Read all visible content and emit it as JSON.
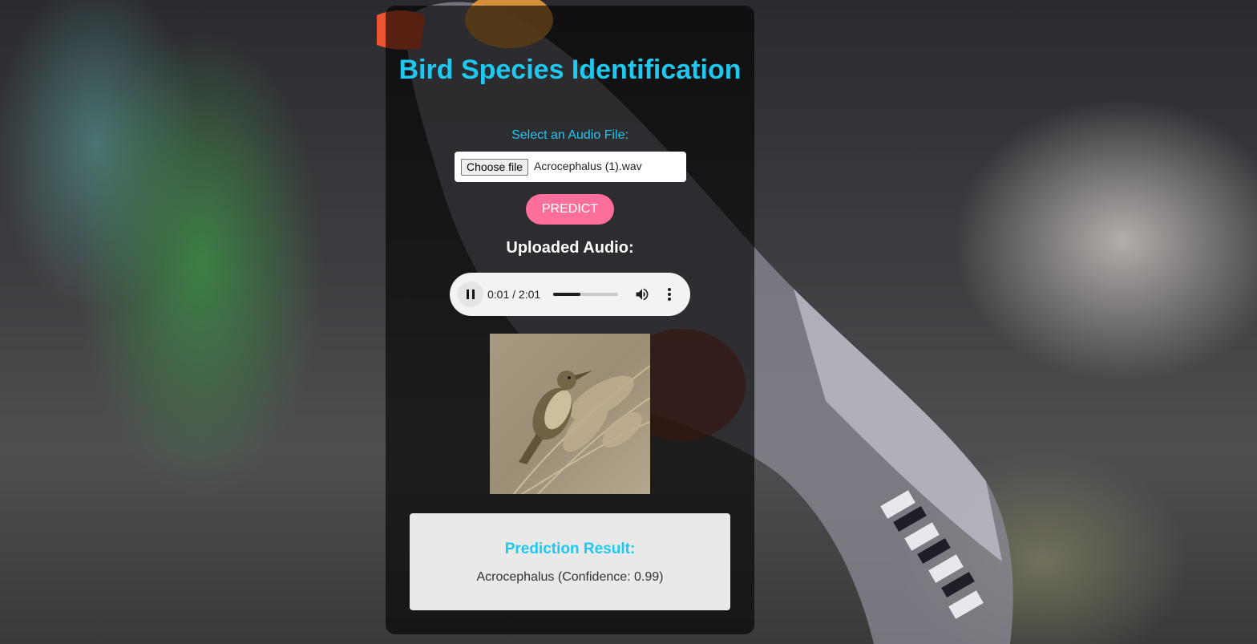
{
  "page": {
    "title": "Bird Species Identification"
  },
  "form": {
    "select_label": "Select an Audio File:",
    "choose_file_label": "Choose file",
    "file_name": "Acrocephalus (1).wav",
    "predict_label": "PREDICT"
  },
  "audio": {
    "heading": "Uploaded Audio:",
    "time_display": "0:01 / 2:01",
    "progress_fraction": 0.42,
    "play_state": "playing",
    "play_icon": "pause-icon",
    "volume_icon": "volume-icon",
    "menu_icon": "more-vert-icon"
  },
  "result": {
    "heading": "Prediction Result:",
    "text": "Acrocephalus (Confidence: 0.99)"
  },
  "colors": {
    "accent": "#1ec8ef",
    "predict_button": "#ff6f9c",
    "panel": "rgba(0,0,0,0.62)",
    "result_box": "#e9e9e9"
  }
}
